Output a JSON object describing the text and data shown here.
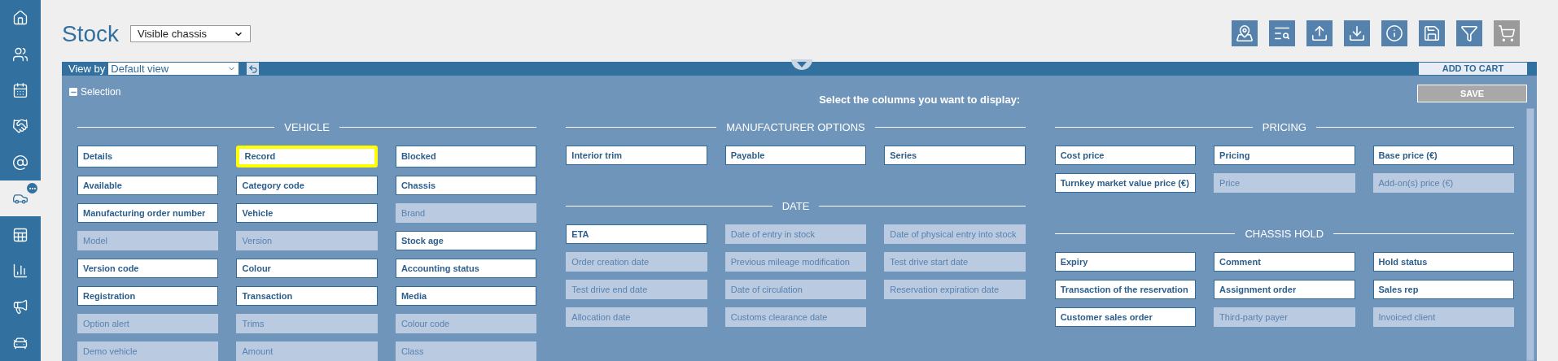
{
  "sidebar": {
    "items": [
      {
        "selected": false,
        "badge": false
      },
      {
        "selected": false,
        "badge": false
      },
      {
        "selected": false,
        "badge": false
      },
      {
        "selected": false,
        "badge": false
      },
      {
        "selected": false,
        "badge": false
      },
      {
        "selected": true,
        "badge": true
      },
      {
        "selected": false,
        "badge": false
      },
      {
        "selected": false,
        "badge": false
      },
      {
        "selected": false,
        "badge": false
      },
      {
        "selected": false,
        "badge": false
      }
    ]
  },
  "header": {
    "title": "Stock",
    "view_select": {
      "value": "Visible chassis"
    }
  },
  "toolbar": [
    {
      "disabled": false
    },
    {
      "disabled": false
    },
    {
      "disabled": false
    },
    {
      "disabled": false
    },
    {
      "disabled": false
    },
    {
      "disabled": false
    },
    {
      "disabled": false
    },
    {
      "disabled": true
    }
  ],
  "panel": {
    "view_by_label": "View by",
    "view_select": {
      "value": "Default view"
    },
    "add_to_cart": "ADD TO CART"
  },
  "selection": {
    "toggle_label": "Selection",
    "expanded": true,
    "prompt": "Select the columns you want to display:",
    "save_button": {
      "label": "SAVE",
      "disabled": true
    },
    "column_groups": [
      [
        {
          "title": "VEHICLE",
          "items": [
            {
              "label": "Details",
              "selected": true,
              "highlighted": false
            },
            {
              "label": "Record",
              "selected": true,
              "highlighted": true
            },
            {
              "label": "Blocked",
              "selected": true,
              "highlighted": false
            },
            {
              "label": "Available",
              "selected": true,
              "highlighted": false
            },
            {
              "label": "Category code",
              "selected": true,
              "highlighted": false
            },
            {
              "label": "Chassis",
              "selected": true,
              "highlighted": false
            },
            {
              "label": "Manufacturing order number",
              "selected": true,
              "highlighted": false
            },
            {
              "label": "Vehicle",
              "selected": true,
              "highlighted": false
            },
            {
              "label": "Brand",
              "selected": false,
              "highlighted": false
            },
            {
              "label": "Model",
              "selected": false,
              "highlighted": false
            },
            {
              "label": "Version",
              "selected": false,
              "highlighted": false
            },
            {
              "label": "Stock age",
              "selected": true,
              "highlighted": false
            },
            {
              "label": "Version code",
              "selected": true,
              "highlighted": false
            },
            {
              "label": "Colour",
              "selected": true,
              "highlighted": false
            },
            {
              "label": "Accounting status",
              "selected": true,
              "highlighted": false
            },
            {
              "label": "Registration",
              "selected": true,
              "highlighted": false
            },
            {
              "label": "Transaction",
              "selected": true,
              "highlighted": false
            },
            {
              "label": "Media",
              "selected": true,
              "highlighted": false
            },
            {
              "label": "Option alert",
              "selected": false,
              "highlighted": false
            },
            {
              "label": "Trims",
              "selected": false,
              "highlighted": false
            },
            {
              "label": "Colour code",
              "selected": false,
              "highlighted": false
            },
            {
              "label": "Demo vehicle",
              "selected": false,
              "highlighted": false
            },
            {
              "label": "Amount",
              "selected": false,
              "highlighted": false
            },
            {
              "label": "Class",
              "selected": false,
              "highlighted": false
            }
          ]
        }
      ],
      [
        {
          "title": "MANUFACTURER OPTIONS",
          "items": [
            {
              "label": "Interior trim",
              "selected": true,
              "highlighted": false
            },
            {
              "label": "Payable",
              "selected": true,
              "highlighted": false
            },
            {
              "label": "Series",
              "selected": true,
              "highlighted": false
            }
          ]
        },
        {
          "title": "DATE",
          "items": [
            {
              "label": "ETA",
              "selected": true,
              "highlighted": false
            },
            {
              "label": "Date of entry in stock",
              "selected": false,
              "highlighted": false
            },
            {
              "label": "Date of physical entry into stock",
              "selected": false,
              "highlighted": false
            },
            {
              "label": "Order creation date",
              "selected": false,
              "highlighted": false
            },
            {
              "label": "Previous mileage modification",
              "selected": false,
              "highlighted": false
            },
            {
              "label": "Test drive start date",
              "selected": false,
              "highlighted": false
            },
            {
              "label": "Test drive end date",
              "selected": false,
              "highlighted": false
            },
            {
              "label": "Date of circulation",
              "selected": false,
              "highlighted": false
            },
            {
              "label": "Reservation expiration date",
              "selected": false,
              "highlighted": false
            },
            {
              "label": "Allocation date",
              "selected": false,
              "highlighted": false
            },
            {
              "label": "Customs clearance date",
              "selected": false,
              "highlighted": false
            }
          ]
        }
      ],
      [
        {
          "title": "PRICING",
          "items": [
            {
              "label": "Cost price",
              "selected": true,
              "highlighted": false
            },
            {
              "label": "Pricing",
              "selected": true,
              "highlighted": false
            },
            {
              "label": "Base price (€)",
              "selected": true,
              "highlighted": false
            },
            {
              "label": "Turnkey market value price (€)",
              "selected": true,
              "highlighted": false
            },
            {
              "label": "Price",
              "selected": false,
              "highlighted": false
            },
            {
              "label": "Add-on(s) price (€)",
              "selected": false,
              "highlighted": false
            }
          ]
        },
        {
          "title": "CHASSIS HOLD",
          "items": [
            {
              "label": "Expiry",
              "selected": true,
              "highlighted": false
            },
            {
              "label": "Comment",
              "selected": true,
              "highlighted": false
            },
            {
              "label": "Hold status",
              "selected": true,
              "highlighted": false
            },
            {
              "label": "Transaction of the reservation",
              "selected": true,
              "highlighted": false
            },
            {
              "label": "Assignment order",
              "selected": true,
              "highlighted": false
            },
            {
              "label": "Sales rep",
              "selected": true,
              "highlighted": false
            },
            {
              "label": "Customer sales order",
              "selected": true,
              "highlighted": false
            },
            {
              "label": "Third-party payer",
              "selected": false,
              "highlighted": false
            },
            {
              "label": "Invoiced client",
              "selected": false,
              "highlighted": false
            }
          ]
        }
      ]
    ]
  }
}
